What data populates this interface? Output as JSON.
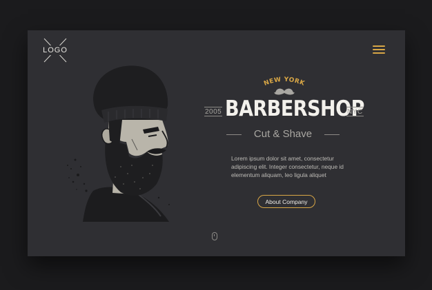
{
  "header": {
    "logo_text": "LOGO",
    "menu_icon": "hamburger-menu-icon"
  },
  "brand": {
    "city": "NEW YORK",
    "year": "2005",
    "title": "BARBERSHOP",
    "place": "NYC",
    "subtitle": "Cut & Shave",
    "icon": "mustache-icon"
  },
  "content": {
    "description": "Lorem ipsum dolor sit amet, consectetur adipiscing elit. Integer consectetur, neque id elementum aliquam, leo ligula aliquet",
    "cta_label": "About Company"
  },
  "colors": {
    "background": "#2f2f33",
    "outer": "#1b1b1d",
    "accent": "#d9a746",
    "text": "#f3f1ec",
    "muted": "#a9a7a2"
  },
  "scroll_indicator_icon": "mouse-scroll-icon"
}
